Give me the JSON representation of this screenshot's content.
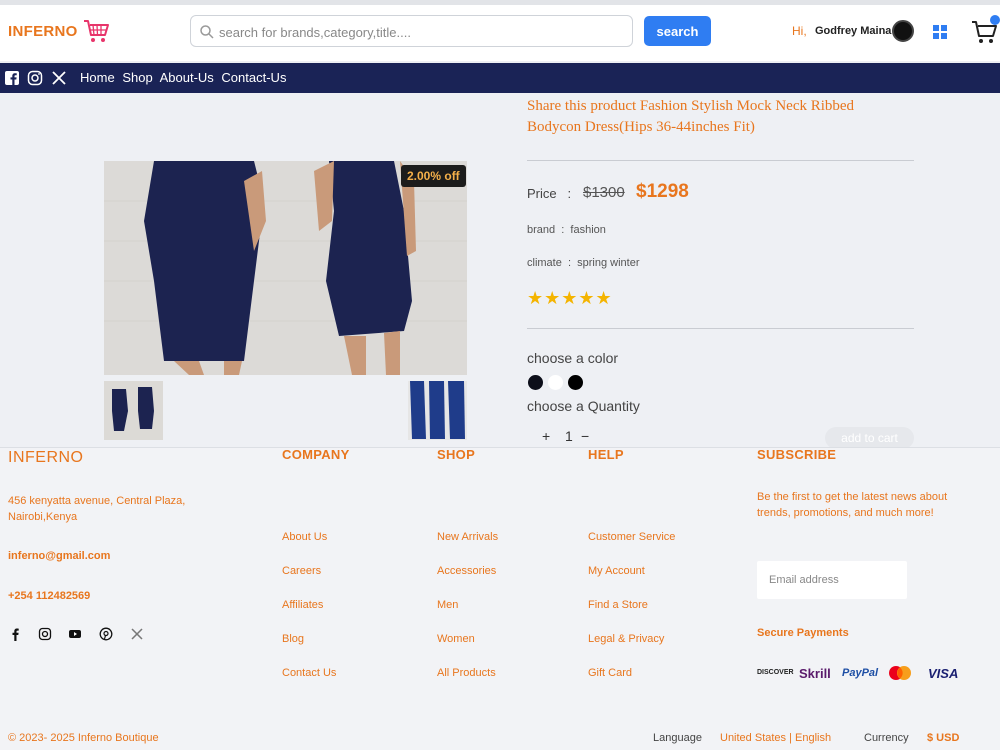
{
  "header": {
    "logo": "INFERNO",
    "search_placeholder": "search for brands,category,title....",
    "search_button": "search",
    "greeting": "Hi,",
    "username": "Godfrey Maina"
  },
  "nav": {
    "links": [
      "Home",
      "Shop",
      "About-Us",
      "Contact-Us"
    ]
  },
  "product": {
    "title": "Share this product Fashion Stylish Mock Neck Ribbed Bodycon Dress(Hips 36-44inches Fit)",
    "discount": "2.00% off",
    "price_label": "Price",
    "price_sep": ":",
    "price_old": "$1300",
    "price_new": "$1298",
    "brand_label": "brand",
    "brand_value": "fashion",
    "climate_label": "climate",
    "climate_value": "spring  winter",
    "rating": 5,
    "stars": "★★★★★",
    "color_label": "choose a color",
    "colors": [
      "#0d0f1a",
      "#ffffff",
      "#000000"
    ],
    "qty_label": "choose a Quantity",
    "qty_plus": "+",
    "qty_value": "1",
    "qty_minus": "−",
    "add_to_cart": "add to cart"
  },
  "footer": {
    "brand": "INFERNO",
    "address": "456 kenyatta avenue, Central Plaza, Nairobi,Kenya",
    "email": "inferno@gmail.com",
    "phone": "+254 112482569",
    "company_head": "COMPANY",
    "company_links": [
      "About Us",
      "Careers",
      "Affiliates",
      "Blog",
      "Contact Us"
    ],
    "shop_head": "SHOP",
    "shop_links": [
      "New Arrivals",
      "Accessories",
      "Men",
      "Women",
      "All Products"
    ],
    "help_head": "HELP",
    "help_links": [
      "Customer Service",
      "My Account",
      "Find a Store",
      "Legal & Privacy",
      "Gift Card"
    ],
    "subscribe_head": "SUBSCRIBE",
    "subscribe_text": "Be the first to get the latest news about trends, promotions, and much more!",
    "email_placeholder": "Email address",
    "secure_payments": "Secure Payments",
    "payments": [
      "DISCOVER",
      "Skrill",
      "PayPal",
      "VISA"
    ],
    "copyright": "© 2023- 2025 Inferno Boutique",
    "language_label": "Language",
    "language_value": "United States | English",
    "currency_label": "Currency",
    "currency_value": "$ USD"
  },
  "colors": {
    "accent": "#e8761e",
    "navbar": "#1a2356",
    "button": "#2f7df2"
  }
}
